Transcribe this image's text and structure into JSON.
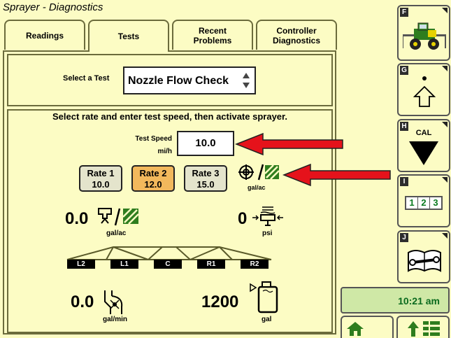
{
  "header": {
    "title": "Sprayer - Diagnostics"
  },
  "tabs": [
    {
      "label": "Readings"
    },
    {
      "label": "Tests"
    },
    {
      "label": "Recent\nProblems"
    },
    {
      "label": "Controller\nDiagnostics"
    }
  ],
  "select_test": {
    "label": "Select a Test",
    "value": "Nozzle Flow Check"
  },
  "instruction": "Select rate and enter test speed, then activate sprayer.",
  "test_speed": {
    "label": "Test Speed",
    "unit": "mi/h",
    "value": "10.0"
  },
  "rates": [
    {
      "name": "Rate 1",
      "value": "10.0"
    },
    {
      "name": "Rate 2",
      "value": "12.0"
    },
    {
      "name": "Rate 3",
      "value": "15.0"
    }
  ],
  "rate_target_unit": "gal/ac",
  "readouts": {
    "applied_rate": {
      "value": "0.0",
      "unit": "gal/ac"
    },
    "pressure": {
      "value": "0",
      "unit": "psi"
    },
    "flow": {
      "value": "0.0",
      "unit": "gal/min"
    },
    "tank": {
      "value": "1200",
      "unit": "gal"
    }
  },
  "boom_sections": [
    "L2",
    "L1",
    "C",
    "R1",
    "R2"
  ],
  "sidebar": {
    "keys": [
      {
        "key": "F",
        "icon": "sprayer-machine-icon"
      },
      {
        "key": "G",
        "icon": "shift-up-icon"
      },
      {
        "key": "H",
        "icon": "calibration-down-icon",
        "label": "CAL"
      },
      {
        "key": "I",
        "icon": "layout-123-icon",
        "digits": [
          "1",
          "2",
          "3"
        ]
      },
      {
        "key": "J",
        "icon": "service-manual-icon"
      }
    ],
    "clock": "10:21 am"
  },
  "colors": {
    "background": "#fcfcc4",
    "selected_rate": "#f2b85c",
    "arrow": "#e5121b",
    "clock_bg": "#cfe8a6",
    "green": "#2e7d1e"
  }
}
